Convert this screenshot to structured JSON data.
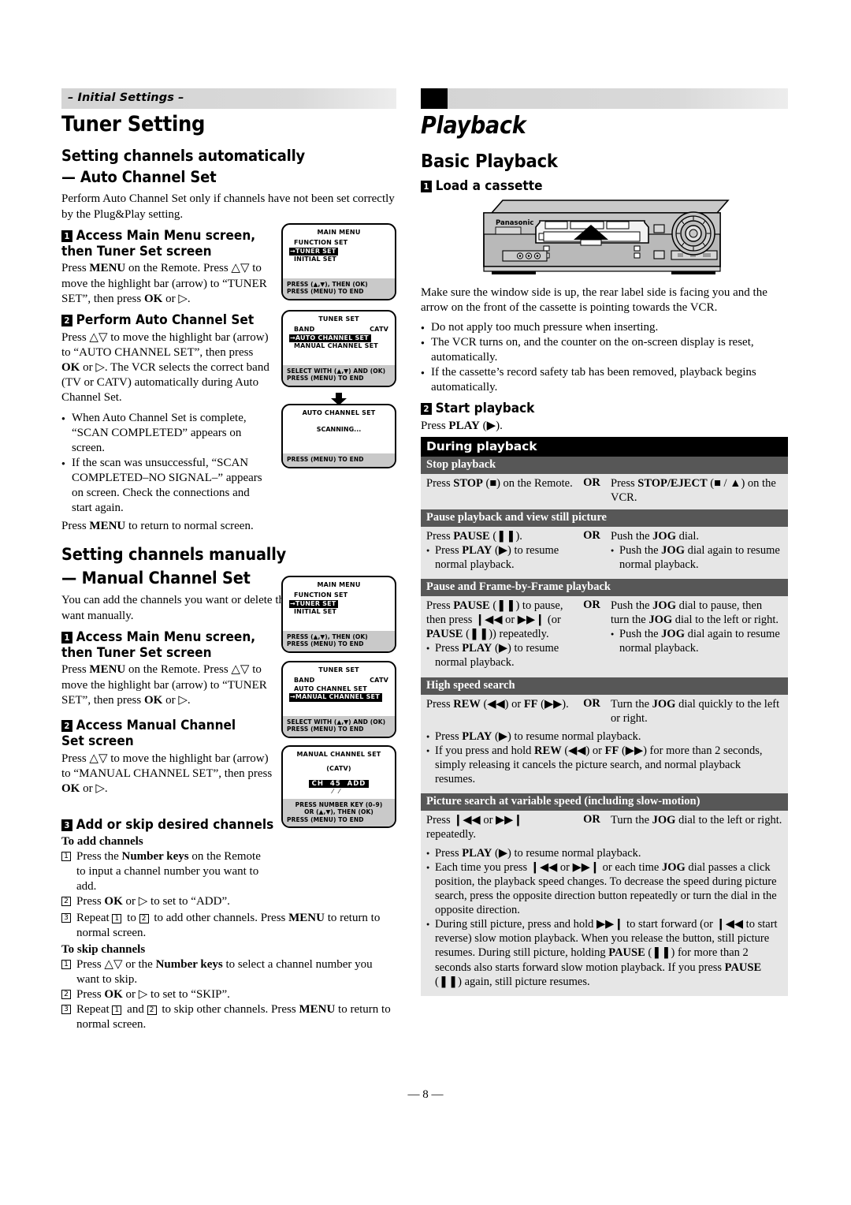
{
  "page": {
    "number": "— 8 —"
  },
  "left": {
    "banner": "– Initial Settings –",
    "section_title": "Tuner Setting",
    "auto": {
      "heading_line1": "Setting channels automatically",
      "heading_line2": "— Auto Channel Set",
      "intro": "Perform Auto Channel Set only if channels have not been set correctly by the Plug&Play setting.",
      "step1_num": "1",
      "step1_title": "Access Main Menu screen, then Tuner Set screen",
      "step1_body_a": "Press ",
      "step1_body_menu": "MENU",
      "step1_body_b": " on the Remote. Press ",
      "step1_body_arrows": "△▽",
      "step1_body_c": " to move the highlight bar (arrow) to “TUNER SET”, then press ",
      "step1_body_ok": "OK",
      "step1_body_d": " or ▷.",
      "step2_num": "2",
      "step2_title": "Perform Auto Channel Set",
      "step2_body_a": "Press △▽ to move the highlight bar (arrow) to “AUTO CHANNEL SET”, then press ",
      "step2_body_ok": "OK",
      "step2_body_b": " or ▷. The VCR selects the correct band (TV or CATV) automatically during Auto Channel Set.",
      "bullet1": "When Auto Channel Set is complete, “SCAN COMPLETED” appears on screen.",
      "bullet2": "If the scan was unsuccessful, “SCAN COMPLETED–NO SIGNAL–” appears on screen. Check the connections and start again.",
      "closing_a": "Press ",
      "closing_menu": "MENU",
      "closing_b": " to return to normal screen."
    },
    "manual": {
      "heading_line1": "Setting channels manually",
      "heading_line2": "— Manual Channel Set",
      "intro": "You can add the channels you want or delete the channels you do not want manually.",
      "step1_num": "1",
      "step1_title": "Access Main Menu screen, then Tuner Set screen",
      "step1_body_a": "Press ",
      "step1_body_menu": "MENU",
      "step1_body_b": " on the Remote. Press △▽ to move the highlight bar (arrow) to “TUNER SET”, then press ",
      "step1_body_ok": "OK",
      "step1_body_c": " or ▷.",
      "step2_num": "2",
      "step2_title": "Access Manual Channel Set screen",
      "step2_body_a": "Press △▽ to move the highlight bar (arrow) to “MANUAL CHANNEL SET”, then press ",
      "step2_body_ok": "OK",
      "step2_body_b": " or ▷.",
      "step3_num": "3",
      "step3_title": "Add or skip desired channels",
      "add_label": "To add channels",
      "add_1_a": "Press the ",
      "add_1_b": "Number keys",
      "add_1_c": " on the Remote to input a channel number you want to add.",
      "add_2_a": "Press ",
      "add_2_ok": "OK",
      "add_2_b": " or ▷ to set to “ADD”.",
      "add_3_a": "Repeat ",
      "add_3_b": " to ",
      "add_3_c": " to add other channels. Press ",
      "add_3_menu": "MENU",
      "add_3_d": " to return to normal screen.",
      "skip_label": "To skip channels",
      "skip_1_a": "Press △▽ or the ",
      "skip_1_b": "Number keys",
      "skip_1_c": " to select a channel number you want to skip.",
      "skip_2_a": "Press ",
      "skip_2_ok": "OK",
      "skip_2_b": " or ▷ to set to “SKIP”.",
      "skip_3_a": "Repeat ",
      "skip_3_b": " and ",
      "skip_3_c": " to skip other channels. Press ",
      "skip_3_menu": "MENU",
      "skip_3_d": " to return to normal screen."
    },
    "screens": {
      "main_menu": {
        "title": "MAIN MENU",
        "item1": "FUNCTION SET",
        "item2": "TUNER SET",
        "item3": "INITIAL SET",
        "footer1": "PRESS (▲,▼), THEN (OK)",
        "footer2": "PRESS (MENU) TO END"
      },
      "tuner_set_auto": {
        "title": "TUNER SET",
        "band_label": "BAND",
        "band_value": "CATV",
        "item_auto": "AUTO CHANNEL SET",
        "item_manual": "MANUAL CHANNEL SET",
        "footer1": "SELECT WITH (▲,▼) AND (OK)",
        "footer2": "PRESS (MENU) TO END"
      },
      "auto_channel_set": {
        "title": "AUTO CHANNEL SET",
        "message": "SCANNING...",
        "footer1": "PRESS (MENU) TO END"
      },
      "tuner_set_manual": {
        "title": "TUNER SET",
        "band_label": "BAND",
        "band_value": "CATV",
        "item_auto": "AUTO CHANNEL SET",
        "item_manual": "MANUAL CHANNEL SET",
        "footer1": "SELECT WITH (▲,▼) AND (OK)",
        "footer2": "PRESS (MENU) TO END"
      },
      "manual_channel_set": {
        "title": "MANUAL CHANNEL SET",
        "band": "(CATV)",
        "ch_label": "CH",
        "ch_number": "45",
        "ch_state": "ADD",
        "footer1": "PRESS NUMBER KEY (0–9)",
        "footer2": "OR (▲,▼), THEN (OK)",
        "footer3": "PRESS (MENU) TO END"
      }
    }
  },
  "right": {
    "section_title": "Playback",
    "sub_title": "Basic Playback",
    "step1_num": "1",
    "step1_title": "Load a cassette",
    "vcr_brand": "Panasonic",
    "intro": "Make sure the window side is up, the rear label side is facing you and the arrow on the front of the cassette is pointing towards the VCR.",
    "bullet1": "Do not apply too much pressure when inserting.",
    "bullet2": "The VCR turns on, and the counter on the on-screen display is reset, automatically.",
    "bullet3": "If the cassette’s record safety tab has been removed, playback begins automatically.",
    "step2_num": "2",
    "step2_title": "Start playback",
    "step2_body_a": "Press ",
    "step2_body_play": "PLAY",
    "step2_body_b": " (▶).",
    "table": {
      "header": "During playback",
      "or_label": "OR",
      "rows": [
        {
          "title": "Stop playback",
          "left_a": "Press ",
          "left_b": "STOP",
          "left_c": " (■) on the Remote.",
          "right_a": "Press ",
          "right_b": "STOP/EJECT",
          "right_c": " (■ / ▲) on the VCR."
        },
        {
          "title": "Pause playback and view still picture",
          "left_a": "Press ",
          "left_b": "PAUSE",
          "left_c": " (❚❚).",
          "left_bullet_a": "Press ",
          "left_bullet_b": "PLAY",
          "left_bullet_c": " (▶) to resume normal playback.",
          "right_a": "Push the ",
          "right_b": "JOG",
          "right_c": " dial.",
          "right_bullet_a": "Push the ",
          "right_bullet_b": "JOG",
          "right_bullet_c": " dial again to resume normal playback."
        },
        {
          "title": "Pause and Frame-by-Frame playback",
          "left_a": "Press ",
          "left_b": "PAUSE",
          "left_c": " (❚❚) to pause, then press ❙◀◀ or ▶▶❙ (or ",
          "left_d": "PAUSE",
          "left_e": " (❚❚)) repeatedly.",
          "left_bullet_a": "Press ",
          "left_bullet_b": "PLAY",
          "left_bullet_c": " (▶) to resume normal playback.",
          "right_a": "Push the ",
          "right_b": "JOG",
          "right_c": " dial to pause, then turn the ",
          "right_d": "JOG",
          "right_e": " dial to the left or right.",
          "right_bullet_a": "Push the ",
          "right_bullet_b": "JOG",
          "right_bullet_c": " dial again to resume normal playback."
        },
        {
          "title": "High speed search",
          "left_a": "Press ",
          "left_b": "REW",
          "left_c": " (◀◀) or ",
          "left_d": "FF",
          "left_e": " (▶▶).",
          "right_a": "Turn the ",
          "right_b": "JOG",
          "right_c": " dial quickly to the left or right.",
          "bullet1_a": "Press ",
          "bullet1_b": "PLAY",
          "bullet1_c": " (▶) to resume normal playback.",
          "bullet2_a": "If you press and hold ",
          "bullet2_b": "REW",
          "bullet2_c": " (◀◀) or ",
          "bullet2_d": "FF",
          "bullet2_e": " (▶▶) for more than 2 seconds, simply releasing it cancels the picture search, and normal playback resumes."
        },
        {
          "title": "Picture search at variable speed (including slow-motion)",
          "left_a": "Press ❙◀◀ or ▶▶❙ repeatedly.",
          "right_a": "Turn the ",
          "right_b": "JOG",
          "right_c": " dial to the left or right.",
          "bullet1_a": "Press ",
          "bullet1_b": "PLAY",
          "bullet1_c": " (▶) to resume normal playback.",
          "bullet2_a": "Each time you press ❙◀◀ or ▶▶❙ or each time ",
          "bullet2_b": "JOG",
          "bullet2_c": " dial passes a click position, the playback speed changes. To decrease the speed during picture search, press the opposite direction button repeatedly or turn the dial in the opposite direction.",
          "bullet3_a": "During still picture, press and hold ▶▶❙ to start forward (or ❙◀◀ to start reverse) slow motion playback. When you release the button, still picture resumes. During still picture, holding ",
          "bullet3_b": "PAUSE",
          "bullet3_c": " (❚❚) for more than 2 seconds also starts forward slow motion playback. If you press ",
          "bullet3_d": "PAUSE",
          "bullet3_e": " (❚❚) again, still picture resumes."
        }
      ]
    }
  }
}
